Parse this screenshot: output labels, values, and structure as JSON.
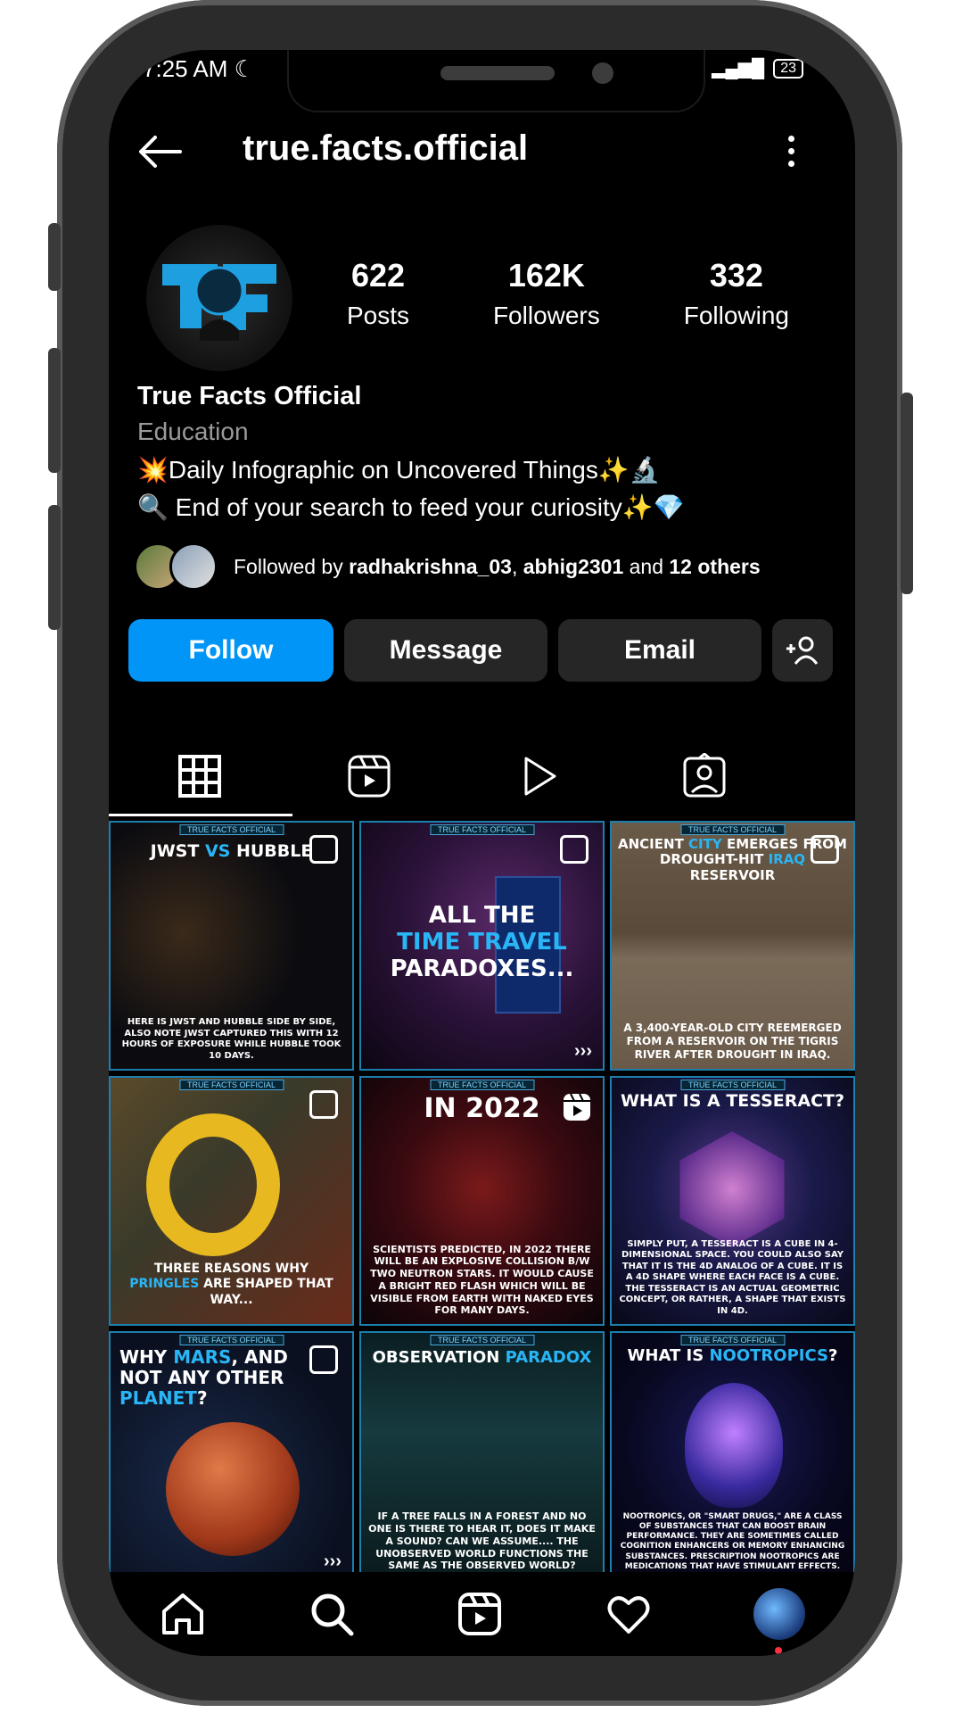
{
  "status": {
    "time": "7:25 AM",
    "battery": "23"
  },
  "header": {
    "username": "true.facts.official"
  },
  "profile": {
    "stats": [
      {
        "num": "622",
        "label": "Posts"
      },
      {
        "num": "162K",
        "label": "Followers"
      },
      {
        "num": "332",
        "label": "Following"
      }
    ],
    "display_name": "True Facts Official",
    "category": "Education",
    "bio_line1": "💥Daily Infographic on Uncovered Things✨🔬",
    "bio_line2": "🔍 End of your search to feed your curiosity✨💎",
    "followed_prefix": "Followed by ",
    "followed_user1": "radhakrishna_03",
    "followed_sep": ", ",
    "followed_user2": "abhig2301",
    "followed_and": " and ",
    "followed_others": "12 others"
  },
  "actions": {
    "follow": "Follow",
    "message": "Message",
    "email": "Email"
  },
  "posts": {
    "brand": "TRUE FACTS OFFICIAL",
    "p1_title_a": "JWST ",
    "p1_title_b": "VS",
    "p1_title_c": " HUBBLE",
    "p1_caption": "Here is JWST and HUBBLE side by side, also note JWST captured this with 12 hours of exposure while HUBBLE took 10 days.",
    "p2_title_a": "All the",
    "p2_title_b": "Time Travel",
    "p2_title_c": "Paradoxes...",
    "p3_title_a": "Ancient ",
    "p3_title_b": "City",
    "p3_title_c": " emerges from drought-hit ",
    "p3_title_d": "Iraq",
    "p3_title_e": " reservoir",
    "p3_caption": "A 3,400-year-old city reemerged from a reservoir on the Tigris River after drought in Iraq.",
    "p4_caption_a": "Three reasons why ",
    "p4_caption_b": "Pringles",
    "p4_caption_c": " are shaped that way...",
    "p5_title": "In 2022",
    "p5_caption": "Scientists predicted, in 2022 there will be an explosive collision b/w two neutron stars. It would cause a bright red flash which will be visible from Earth with naked eyes for many days.",
    "p6_title": "What is a Tesseract?",
    "p6_caption": "Simply put, a tesseract is a cube in 4-dimensional space. You could also say that it is the 4D analog of a cube. It is a 4D shape where each face is a cube. The tesseract is an actual geometric concept, or rather, a shape that exists in 4D.",
    "p7_title_a": "Why ",
    "p7_title_b": "Mars",
    "p7_title_c": ", and not any other ",
    "p7_title_d": "planet",
    "p7_title_e": "?",
    "p8_title_a": "Observation ",
    "p8_title_b": "Paradox",
    "p8_caption": "If a tree falls in a forest and no one is there to hear it, does it make a sound? Can we assume.... the unobserved world functions the same as the observed world?",
    "p9_title_a": "What is ",
    "p9_title_b": "Nootropics",
    "p9_title_c": "?",
    "p9_caption": "Nootropics, or \"smart drugs,\" are a class of substances that can boost brain performance. They are sometimes called cognition enhancers or memory enhancing substances. Prescription nootropics are medications that have stimulant effects.",
    "more": "›››"
  }
}
